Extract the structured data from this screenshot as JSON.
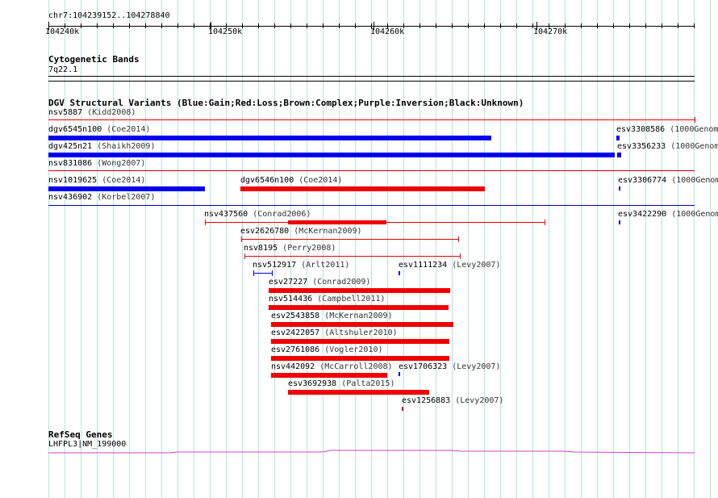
{
  "ruler": {
    "location": "chr7:104239152..104278840",
    "major_ticks": [
      {
        "label": "104240k",
        "pos": 0
      },
      {
        "label": "104250k",
        "pos": 1
      },
      {
        "label": "104260k",
        "pos": 2
      },
      {
        "label": "104270k",
        "pos": 3
      }
    ]
  },
  "cyto": {
    "title": "Cytogenetic Bands",
    "band": "7q22.1"
  },
  "dgv": {
    "title": "DGV Structural Variants (Blue:Gain;Red:Loss;Brown:Complex;Purple:Inversion;Black:Unknown)",
    "colors": {
      "gain": "#0000ee",
      "loss": "#ee0000",
      "separator_red": "#dd0000",
      "separator_blue": "#0000cc"
    },
    "features": [
      {
        "id": "nsv5887",
        "source": "(Kidd2008)",
        "type": "loss",
        "style": "thin"
      },
      {
        "id": "dgv6545n100",
        "source": "(Coe2014)",
        "type": "gain",
        "style": "thick"
      },
      {
        "id": "esv3308586",
        "source": "(1000Genom",
        "type": "gain",
        "style": "dot"
      },
      {
        "id": "dgv425n21",
        "source": "(Shaikh2009)",
        "type": "gain",
        "style": "thick"
      },
      {
        "id": "esv3356233",
        "source": "(1000Genom",
        "type": "gain",
        "style": "dot"
      },
      {
        "id": "nsv831086",
        "source": "(Wong2007)",
        "type": "loss",
        "style": "separator"
      },
      {
        "id": "nsv1019625",
        "source": "(Coe2014)",
        "type": "gain",
        "style": "thick"
      },
      {
        "id": "dgv6546n100",
        "source": "(Coe2014)",
        "type": "loss",
        "style": "thick"
      },
      {
        "id": "esv3306774",
        "source": "(1000Genom",
        "type": "gain",
        "style": "tick"
      },
      {
        "id": "nsv436902",
        "source": "(Korbel2007)",
        "type": "gain",
        "style": "separator"
      },
      {
        "id": "nsv437560",
        "source": "(Conrad2006)",
        "type": "loss",
        "style": "mixed"
      },
      {
        "id": "esv3422290",
        "source": "(1000Genom",
        "type": "gain",
        "style": "tick"
      },
      {
        "id": "esv2626780",
        "source": "(McKernan2009)",
        "type": "loss",
        "style": "thin"
      },
      {
        "id": "nsv8195",
        "source": "(Perry2008)",
        "type": "loss",
        "style": "thin"
      },
      {
        "id": "nsv512917",
        "source": "(Arlt2011)",
        "type": "gain",
        "style": "thin"
      },
      {
        "id": "esv1111234",
        "source": "(Levy2007)",
        "type": "gain",
        "style": "tick"
      },
      {
        "id": "esv27227",
        "source": "(Conrad2009)",
        "type": "loss",
        "style": "thick"
      },
      {
        "id": "nsv514436",
        "source": "(Campbell2011)",
        "type": "loss",
        "style": "thick"
      },
      {
        "id": "esv2543858",
        "source": "(McKernan2009)",
        "type": "loss",
        "style": "thick"
      },
      {
        "id": "esv2422057",
        "source": "(Altshuler2010)",
        "type": "loss",
        "style": "thick"
      },
      {
        "id": "esv2761086",
        "source": "(Vogler2010)",
        "type": "loss",
        "style": "thick"
      },
      {
        "id": "nsv442092",
        "source": "(McCarroll2008)",
        "type": "loss",
        "style": "thick"
      },
      {
        "id": "esv1706323",
        "source": "(Levy2007)",
        "type": "gain",
        "style": "tick"
      },
      {
        "id": "esv3692938",
        "source": "(Palta2015)",
        "type": "loss",
        "style": "thick"
      },
      {
        "id": "esv1256883",
        "source": "(Levy2007)",
        "type": "loss",
        "style": "tick"
      }
    ]
  },
  "refseq": {
    "title": "RefSeq Genes",
    "gene_label": "LHFPL3|NM_199000",
    "color": "#cc44cc"
  }
}
